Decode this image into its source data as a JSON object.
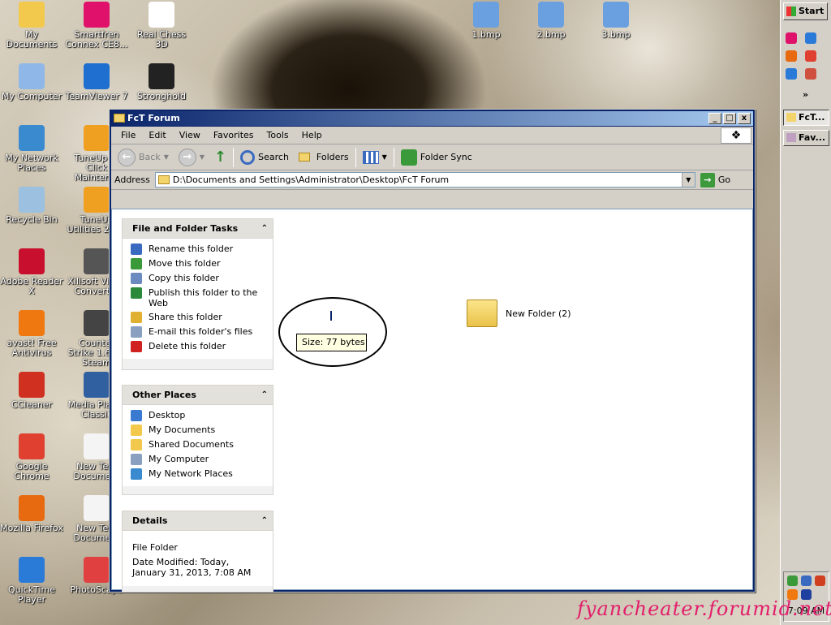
{
  "desktop_icons": [
    {
      "label": "My Documents",
      "icon": "my-documents-icon",
      "color": "#f2c94c"
    },
    {
      "label": "Smartfren Connex CE8...",
      "icon": "smartfren-icon",
      "color": "#e0116b"
    },
    {
      "label": "Real Chess 3D",
      "icon": "chess-icon",
      "color": "#ffffff"
    },
    {
      "label": "1.bmp",
      "icon": "bitmap-file-icon",
      "color": "#6aa0e0"
    },
    {
      "label": "2.bmp",
      "icon": "bitmap-file-icon",
      "color": "#6aa0e0"
    },
    {
      "label": "3.bmp",
      "icon": "bitmap-file-icon",
      "color": "#6aa0e0"
    },
    {
      "label": "My Computer",
      "icon": "my-computer-icon",
      "color": "#8fb8e8"
    },
    {
      "label": "TeamViewer 7",
      "icon": "teamviewer-icon",
      "color": "#1e6fd0"
    },
    {
      "label": "Stronghold",
      "icon": "stronghold-icon",
      "color": "#222222"
    },
    {
      "label": "My Network Places",
      "icon": "network-places-icon",
      "color": "#3a8ad0"
    },
    {
      "label": "TuneUp 1-Click Mainten...",
      "icon": "tuneup-icon",
      "color": "#f0a020"
    },
    {
      "label": "Recycle Bin",
      "icon": "recycle-bin-icon",
      "color": "#9bc0e0"
    },
    {
      "label": "TuneUp Utilities 2012",
      "icon": "tuneup-utilities-icon",
      "color": "#f0a020"
    },
    {
      "label": "Adobe Reader X",
      "icon": "adobe-reader-icon",
      "color": "#c8102e"
    },
    {
      "label": "Xilisoft Video Converter",
      "icon": "xilisoft-icon",
      "color": "#555555"
    },
    {
      "label": "avast! Free Antivirus",
      "icon": "avast-icon",
      "color": "#f07810"
    },
    {
      "label": "Counter Strike 1.6 No Steam",
      "icon": "counter-strike-icon",
      "color": "#444444"
    },
    {
      "label": "CCleaner",
      "icon": "ccleaner-icon",
      "color": "#d03020"
    },
    {
      "label": "Media Player Classic",
      "icon": "media-player-icon",
      "color": "#3060a0"
    },
    {
      "label": "Google Chrome",
      "icon": "chrome-icon",
      "color": "#e04030"
    },
    {
      "label": "New Text Document",
      "icon": "text-document-icon",
      "color": "#f4f4f4"
    },
    {
      "label": "Mozilla Firefox",
      "icon": "firefox-icon",
      "color": "#e86a10"
    },
    {
      "label": "New Text Document",
      "icon": "text-document-icon",
      "color": "#f4f4f4"
    },
    {
      "label": "QuickTime Player",
      "icon": "quicktime-icon",
      "color": "#2a7ad8"
    },
    {
      "label": "PhotoScape",
      "icon": "photoscape-icon",
      "color": "#e04040"
    }
  ],
  "window": {
    "title": "FcT Forum",
    "minimize": "_",
    "maximize": "□",
    "close": "x"
  },
  "menu": [
    "File",
    "Edit",
    "View",
    "Favorites",
    "Tools",
    "Help"
  ],
  "toolbar": {
    "back": "Back",
    "forward_arrow": "→",
    "back_arrow": "←",
    "up_arrow": "↑",
    "search": "Search",
    "folders": "Folders",
    "folder_sync": "Folder Sync"
  },
  "address": {
    "label": "Address",
    "value": "D:\\Documents and Settings\\Administrator\\Desktop\\FcT Forum",
    "go": "Go"
  },
  "tasks_panel": {
    "title": "File and Folder Tasks",
    "items": [
      {
        "label": "Rename this folder",
        "icon": "rename-icon",
        "color": "#3a6ac0"
      },
      {
        "label": "Move this folder",
        "icon": "move-folder-icon",
        "color": "#3a9a3a"
      },
      {
        "label": "Copy this folder",
        "icon": "copy-folder-icon",
        "color": "#6a8ac0"
      },
      {
        "label": "Publish this folder to the Web",
        "icon": "publish-web-icon",
        "color": "#2a8a3a"
      },
      {
        "label": "Share this folder",
        "icon": "share-folder-icon",
        "color": "#e0b030"
      },
      {
        "label": "E-mail this folder's files",
        "icon": "email-icon",
        "color": "#8aa0c0"
      },
      {
        "label": "Delete this folder",
        "icon": "delete-icon",
        "color": "#d02020"
      }
    ]
  },
  "places_panel": {
    "title": "Other Places",
    "items": [
      {
        "label": "Desktop",
        "icon": "desktop-icon",
        "color": "#3a7ad0"
      },
      {
        "label": "My Documents",
        "icon": "my-documents-icon",
        "color": "#f2c94c"
      },
      {
        "label": "Shared Documents",
        "icon": "shared-documents-icon",
        "color": "#f2c94c"
      },
      {
        "label": "My Computer",
        "icon": "my-computer-icon",
        "color": "#8aa0c0"
      },
      {
        "label": "My Network Places",
        "icon": "network-places-icon",
        "color": "#3a8ad0"
      }
    ]
  },
  "details_panel": {
    "title": "Details",
    "type": "File Folder",
    "modified": "Date Modified: Today, January 31, 2013, 7:08 AM"
  },
  "collapse_glyph": "⌃",
  "file_area": {
    "tooltip": "Size: 77 bytes",
    "folder_name": "New Folder (2)"
  },
  "taskbar": {
    "start": "Start",
    "chevron": "»",
    "quick_launch": [
      {
        "icon": "smartfren-icon",
        "color": "#e0116b"
      },
      {
        "icon": "ie-icon",
        "color": "#2a7ad8"
      },
      {
        "icon": "firefox-icon",
        "color": "#e86a10"
      },
      {
        "icon": "chrome-icon",
        "color": "#e04030"
      },
      {
        "icon": "ie-icon",
        "color": "#2a7ad8"
      },
      {
        "icon": "app-icon",
        "color": "#d05040"
      }
    ],
    "tasks": [
      {
        "label": "FcT...",
        "icon": "folder-icon",
        "active": true
      },
      {
        "label": "Fav...",
        "icon": "favorites-icon",
        "active": false
      }
    ],
    "tray_icons": [
      {
        "icon": "network-tray-icon",
        "color": "#3a9a3a"
      },
      {
        "icon": "search-tray-icon",
        "color": "#3a6ac0"
      },
      {
        "icon": "security-tray-icon",
        "color": "#d04020"
      },
      {
        "icon": "avast-tray-icon",
        "color": "#f07810"
      },
      {
        "icon": "app-tray-icon",
        "color": "#2040a0"
      }
    ],
    "clock": "7:09 AM"
  },
  "watermark": "fyancheater.forumid.net"
}
